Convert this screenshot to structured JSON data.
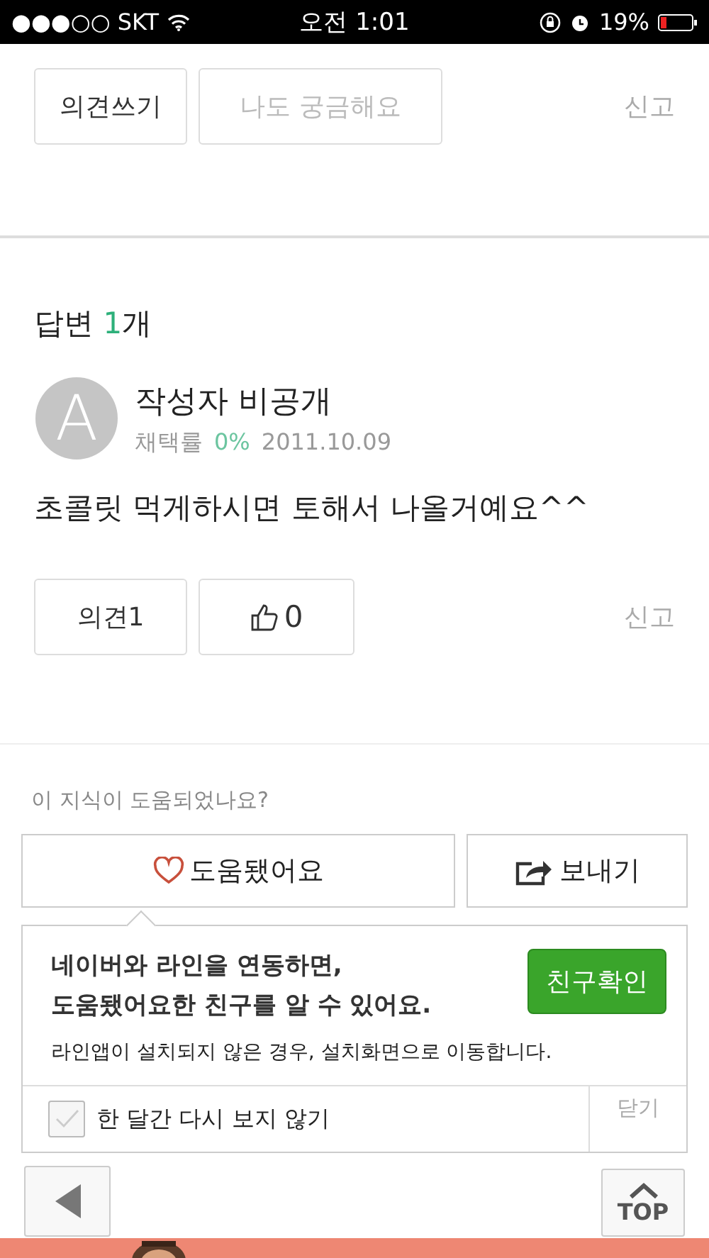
{
  "status_bar": {
    "carrier": "●●●○○ SKT",
    "time": "오전 1:01",
    "battery": "19%"
  },
  "question_actions": [
    {
      "label": "의견쓰기",
      "disabled": false
    },
    {
      "label": "나도 궁금해요",
      "disabled": true
    }
  ],
  "question_report": "신고",
  "answers_heading": {
    "label": "답변 ",
    "count": "1",
    "unit": "개"
  },
  "answer": {
    "avatar_letter": "A",
    "author": "작성자 비공개",
    "rate_label": "채택률",
    "rate": "0%",
    "date": "2011.10.09",
    "body": "초콜릿 먹게하시면 토해서 나올거예요^^",
    "comment_button": "의견1",
    "like_count": "0",
    "report": "신고"
  },
  "feedback": {
    "prompt": "이 지식이 도움되었나요?",
    "helpful_button": "도움됐어요",
    "send_button": "보내기"
  },
  "popup": {
    "headline": "네이버와 라인을 연동하면,\n도움됐어요한 친구를 알 수 있어요.",
    "note": "라인앱이 설치되지 않은 경우, 설치화면으로 이동합니다.",
    "action_button": "친구확인",
    "dont_show": {
      "label": "한 달간 다시 보지 않기",
      "checked": false
    },
    "close": "닫기"
  },
  "floating": {
    "top_button": "TOP"
  }
}
